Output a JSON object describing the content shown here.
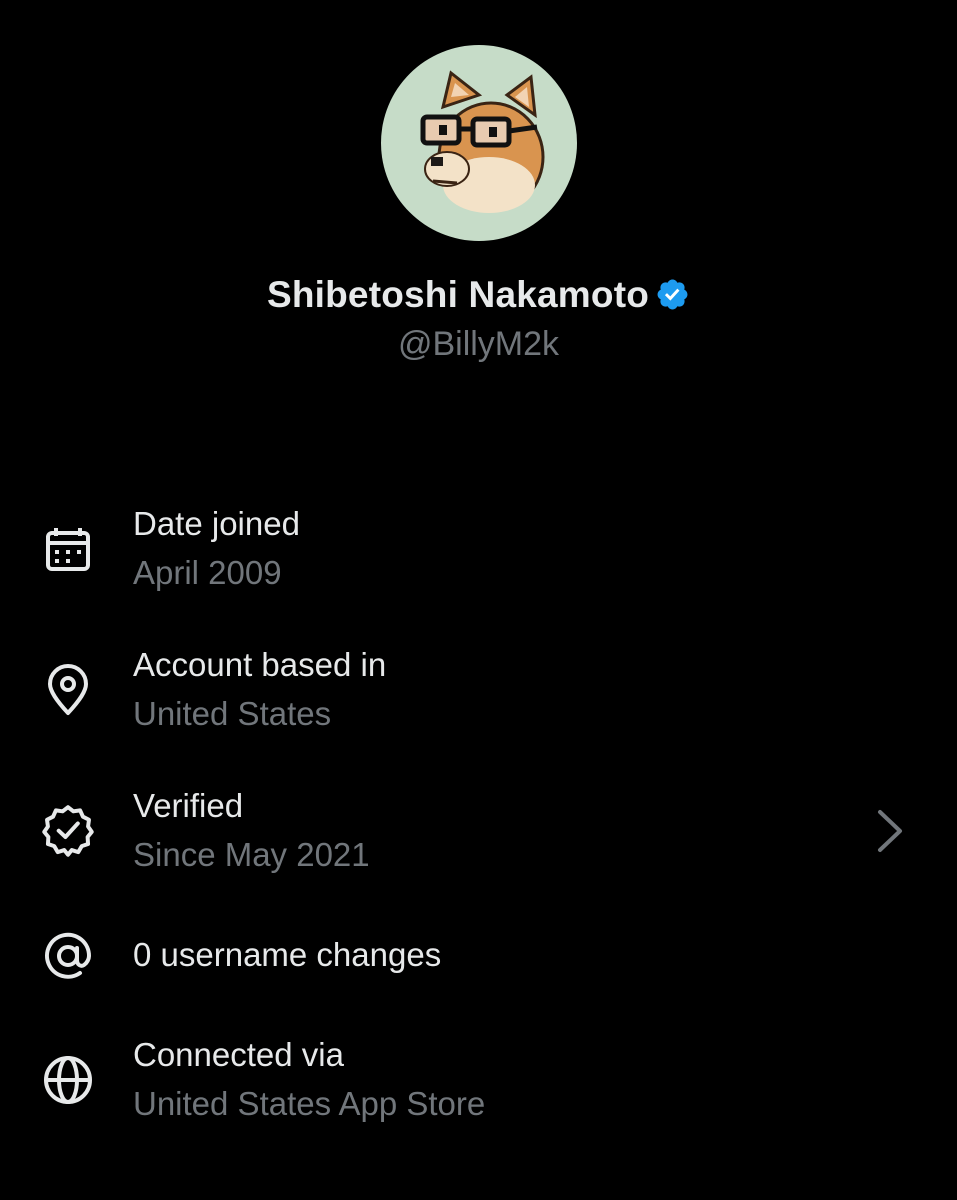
{
  "profile": {
    "display_name": "Shibetoshi Nakamoto",
    "handle": "@BillyM2k",
    "verified": true,
    "avatar_icon": "doge-pixel-avatar",
    "avatar_bg": "#c6dcc8"
  },
  "colors": {
    "background": "#000000",
    "primary_text": "#e7e9ea",
    "secondary_text": "#71767b",
    "verified_blue": "#1d9bf0"
  },
  "info_rows": [
    {
      "icon": "calendar-icon",
      "title": "Date joined",
      "subtitle": "April 2009"
    },
    {
      "icon": "location-pin-icon",
      "title": "Account based in",
      "subtitle": "United States"
    },
    {
      "icon": "verified-badge-icon",
      "title": "Verified",
      "subtitle": "Since May 2021",
      "chevron": "chevron-right-icon"
    },
    {
      "icon": "at-sign-icon",
      "title": "0 username changes"
    },
    {
      "icon": "globe-icon",
      "title": "Connected via",
      "subtitle": "United States App Store"
    }
  ]
}
